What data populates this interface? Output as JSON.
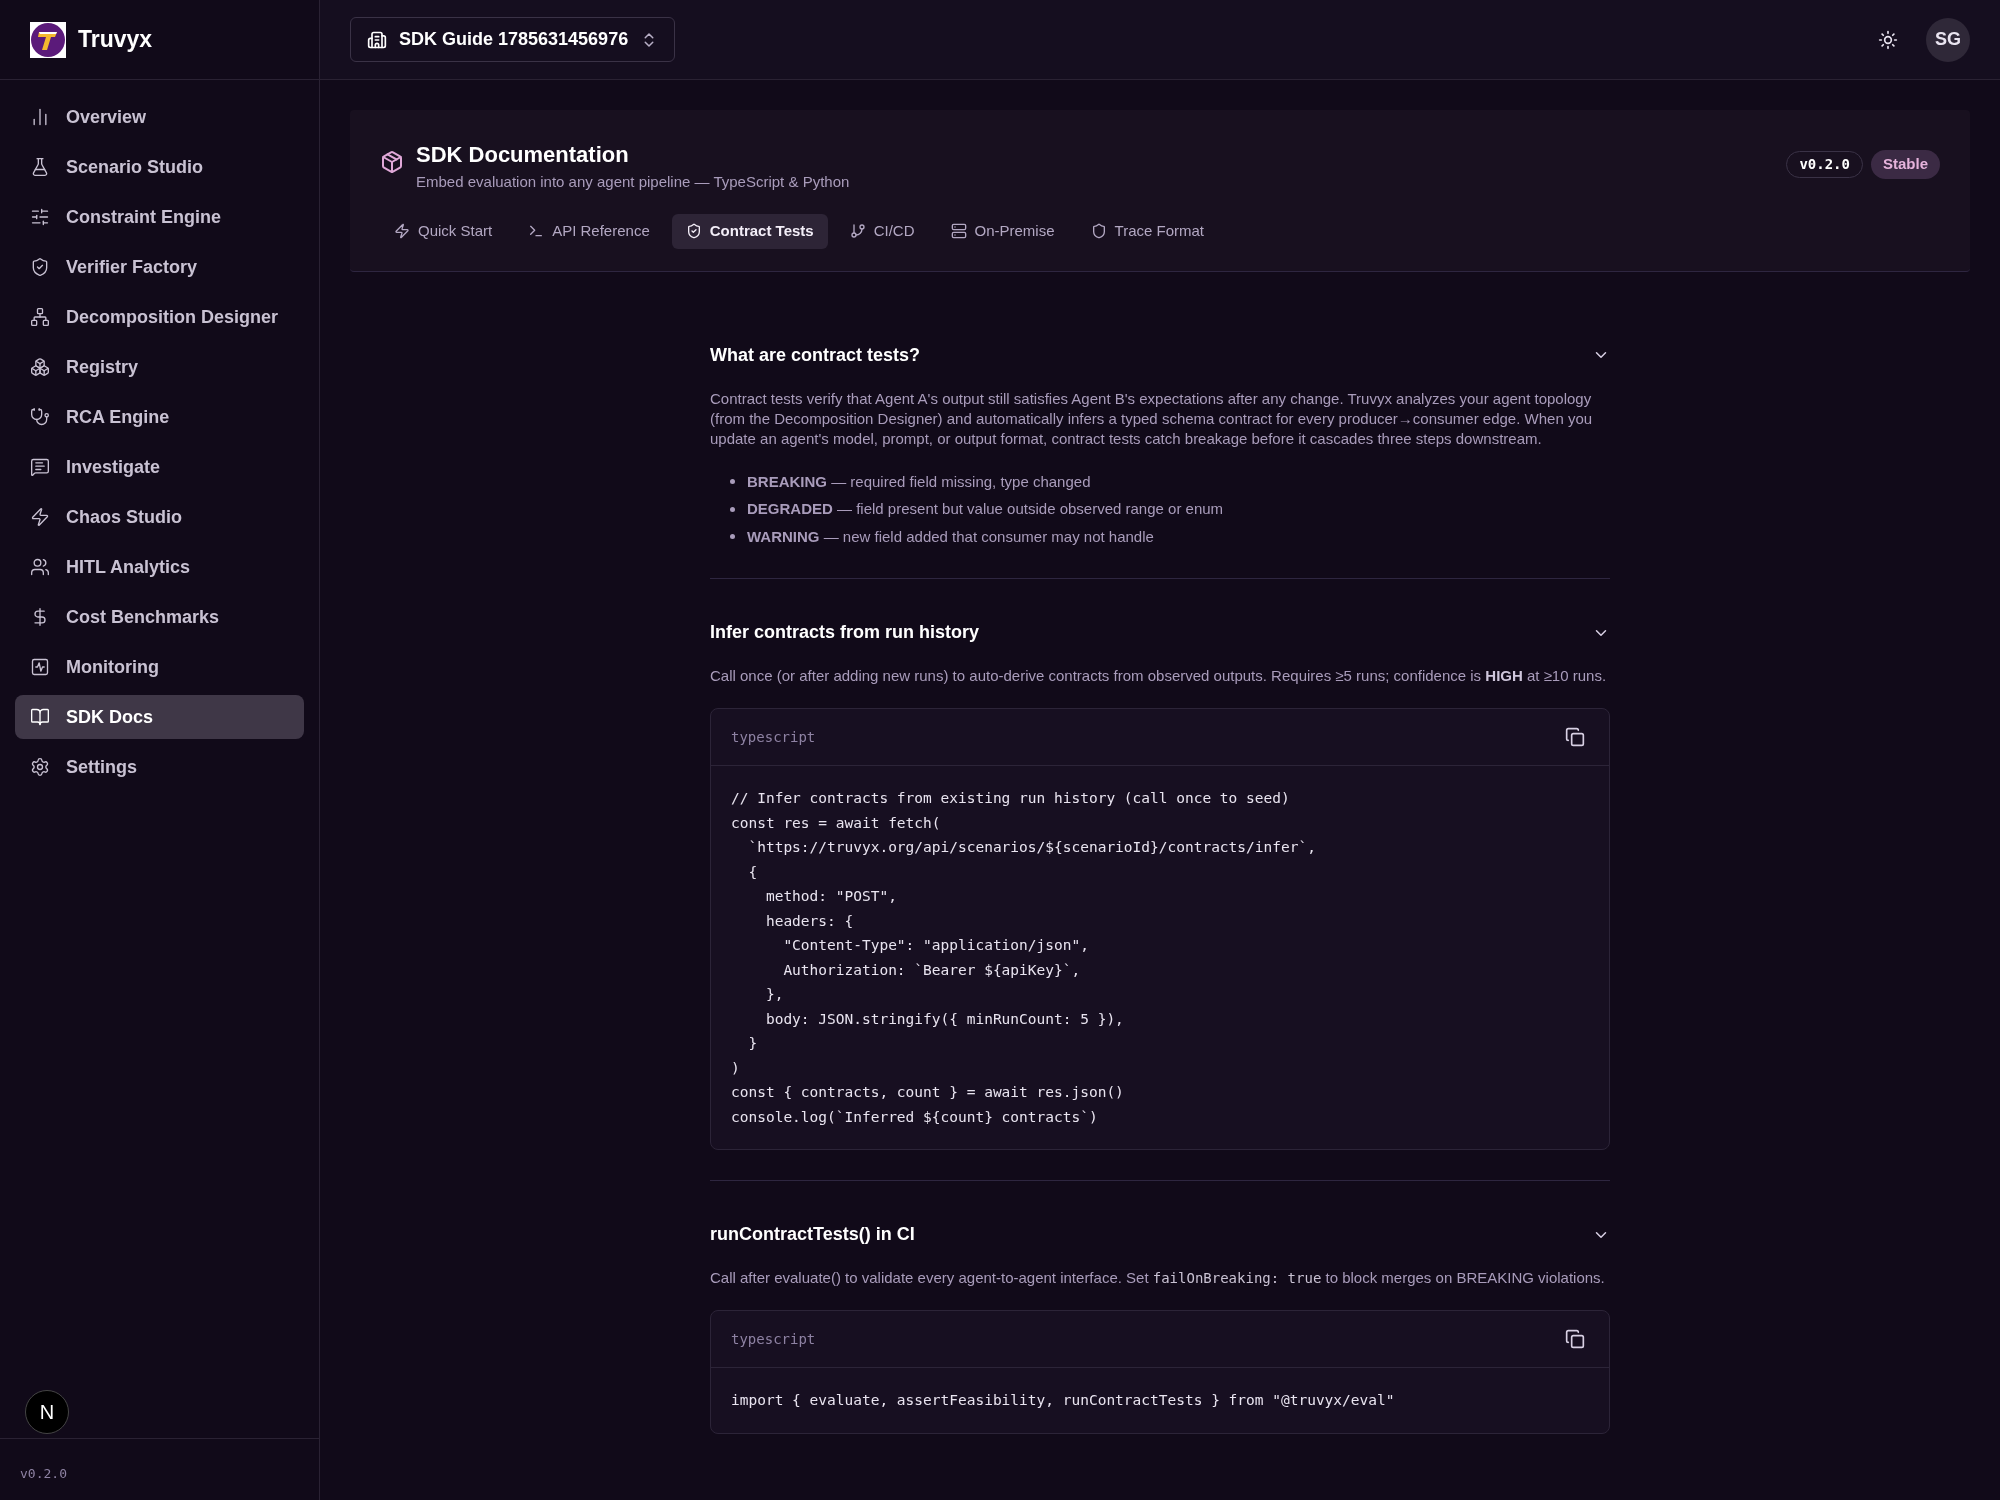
{
  "brand": {
    "name": "Truvyx"
  },
  "nav": {
    "items": [
      {
        "label": "Overview",
        "selected": false
      },
      {
        "label": "Scenario Studio",
        "selected": false
      },
      {
        "label": "Constraint Engine",
        "selected": false
      },
      {
        "label": "Verifier Factory",
        "selected": false
      },
      {
        "label": "Decomposition Designer",
        "selected": false
      },
      {
        "label": "Registry",
        "selected": false
      },
      {
        "label": "RCA Engine",
        "selected": false
      },
      {
        "label": "Investigate",
        "selected": false
      },
      {
        "label": "Chaos Studio",
        "selected": false
      },
      {
        "label": "HITL Analytics",
        "selected": false
      },
      {
        "label": "Cost Benchmarks",
        "selected": false
      },
      {
        "label": "Monitoring",
        "selected": false
      },
      {
        "label": "SDK Docs",
        "selected": true
      },
      {
        "label": "Settings",
        "selected": false
      }
    ]
  },
  "sidebar_footer": {
    "version": "v0.2.0",
    "badge": "N"
  },
  "topbar": {
    "workspace": "SDK Guide 1785631456976",
    "avatar": "SG"
  },
  "header": {
    "title": "SDK Documentation",
    "subtitle": "Embed evaluation into any agent pipeline — TypeScript & Python",
    "version": "v0.2.0",
    "status": "Stable",
    "tabs": [
      {
        "label": "Quick Start",
        "selected": false
      },
      {
        "label": "API Reference",
        "selected": false
      },
      {
        "label": "Contract Tests",
        "selected": true
      },
      {
        "label": "CI/CD",
        "selected": false
      },
      {
        "label": "On-Premise",
        "selected": false
      },
      {
        "label": "Trace Format",
        "selected": false
      }
    ]
  },
  "sections": [
    {
      "title": "What are contract tests?",
      "expanded": true,
      "paragraph": [
        {
          "kind": "text",
          "text": "Contract tests verify that Agent A's output still satisfies Agent B's expectations after any change. Truvyx analyzes your agent topology (from the Decomposition Designer) and automatically infers a typed schema contract for every producer→consumer edge. When you update an agent's model, prompt, or output format, contract tests catch breakage before it cascades three steps downstream."
        }
      ],
      "bullets": [
        "**BREAKING** — required field missing, type changed",
        "**DEGRADED** — field present but value outside observed range or enum",
        "**WARNING** — new field added that consumer may not handle"
      ]
    },
    {
      "title": "Infer contracts from run history",
      "expanded": true,
      "paragraph": [
        {
          "kind": "text",
          "text": "Call once (or after adding new runs) to auto-derive contracts from observed outputs. Requires ≥5 runs; confidence is **HIGH** at ≥10 runs."
        }
      ],
      "code": {
        "language": "typescript",
        "lines": [
          "// Infer contracts from existing run history (call once to seed)",
          "const res = await fetch(",
          "  `https://truvyx.org/api/scenarios/${scenarioId}/contracts/infer`,",
          "  {",
          "    method: \"POST\",",
          "    headers: {",
          "      \"Content-Type\": \"application/json\",",
          "      Authorization: `Bearer ${apiKey}`,",
          "    },",
          "    body: JSON.stringify({ minRunCount: 5 }),",
          "  }",
          ")",
          "const { contracts, count } = await res.json()",
          "console.log(`Inferred ${count} contracts`)"
        ]
      }
    },
    {
      "title": "runContractTests() in CI",
      "expanded": true,
      "paragraph": [
        {
          "kind": "text",
          "text": "Call after evaluate() to validate every agent-to-agent interface. Set "
        },
        {
          "kind": "code",
          "text": "failOnBreaking: true"
        },
        {
          "kind": "text",
          "text": " to block merges on BREAKING violations."
        }
      ],
      "code": {
        "language": "typescript",
        "lines": [
          "import { evaluate, assertFeasibility, runContractTests } from \"@truvyx/eval\""
        ]
      }
    }
  ]
}
